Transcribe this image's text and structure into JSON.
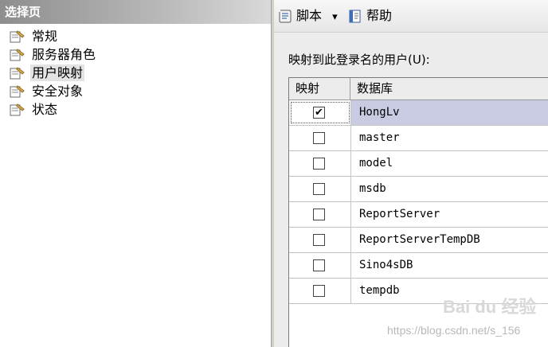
{
  "left_panel": {
    "header": "选择页",
    "items": [
      {
        "label": "常规",
        "selected": false
      },
      {
        "label": "服务器角色",
        "selected": false
      },
      {
        "label": "用户映射",
        "selected": true
      },
      {
        "label": "安全对象",
        "selected": false
      },
      {
        "label": "状态",
        "selected": false
      }
    ]
  },
  "toolbar": {
    "script_label": "脚本",
    "script_dropdown": "▾",
    "help_label": "帮助"
  },
  "mapping": {
    "caption": "映射到此登录名的用户(U):",
    "columns": {
      "map": "映射",
      "database": "数据库"
    },
    "rows": [
      {
        "checked": true,
        "check_glyph": "✔",
        "database": "HongLv"
      },
      {
        "checked": false,
        "check_glyph": "",
        "database": "master"
      },
      {
        "checked": false,
        "check_glyph": "",
        "database": "model"
      },
      {
        "checked": false,
        "check_glyph": "",
        "database": "msdb"
      },
      {
        "checked": false,
        "check_glyph": "",
        "database": "ReportServer"
      },
      {
        "checked": false,
        "check_glyph": "",
        "database": "ReportServerTempDB"
      },
      {
        "checked": false,
        "check_glyph": "",
        "database": "Sino4sDB"
      },
      {
        "checked": false,
        "check_glyph": "",
        "database": "tempdb"
      }
    ]
  },
  "watermark": {
    "logo": "Bai du 经验",
    "url": "https://blog.csdn.net/s_156"
  },
  "colors": {
    "selected_row": "#c9cbe3",
    "header_gradient_start": "#8e8e8e",
    "panel_bg": "#ececec"
  }
}
